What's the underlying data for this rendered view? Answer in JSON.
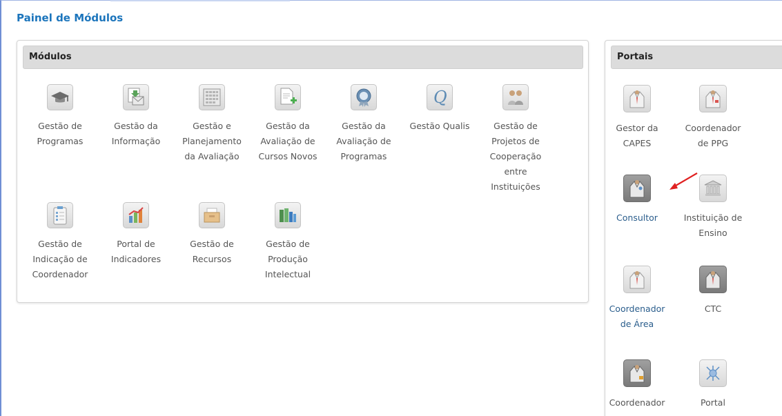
{
  "page": {
    "title": "Painel de Módulos"
  },
  "modulos": {
    "header": "Módulos",
    "items": [
      {
        "label": "Gestão de Programas",
        "icon": "graduation-cap-icon"
      },
      {
        "label": "Gestão da Informação",
        "icon": "document-mail-icon"
      },
      {
        "label": "Gestão e Planejamento da Avaliação",
        "icon": "calendar-grid-icon"
      },
      {
        "label": "Gestão da Avaliação de Cursos Novos",
        "icon": "document-add-icon"
      },
      {
        "label": "Gestão da Avaliação de Programas",
        "icon": "award-rosette-icon"
      },
      {
        "label": "Gestão Qualis",
        "icon": "qualis-q-icon"
      },
      {
        "label": "Gestão de Projetos de Cooperação entre Instituições",
        "icon": "people-cooperation-icon"
      },
      {
        "label": "Gestão de Indicação de Coordenador",
        "icon": "clipboard-list-icon"
      },
      {
        "label": "Portal de Indicadores",
        "icon": "chart-indicators-icon"
      },
      {
        "label": "Gestão de Recursos",
        "icon": "folder-box-icon"
      },
      {
        "label": "Gestão de Produção Intelectual",
        "icon": "books-icon"
      }
    ]
  },
  "portais": {
    "header": "Portais",
    "items": [
      {
        "label": "Gestor da CAPES",
        "icon": "user-coat-icon"
      },
      {
        "label": "Coordenador de PPG",
        "icon": "user-coat-tie-icon"
      },
      {
        "label": "Consultor",
        "icon": "user-coat-dark-icon"
      },
      {
        "label": "Instituição de Ensino",
        "icon": "institution-building-icon"
      },
      {
        "label": "Coordenador de Área",
        "icon": "user-coat-tie-icon"
      },
      {
        "label": "CTC",
        "icon": "user-coat-dark-icon"
      },
      {
        "label": "Coordenador",
        "icon": "user-coat-dark-icon"
      },
      {
        "label": "Portal",
        "icon": "globe-network-icon"
      }
    ]
  },
  "colors": {
    "title": "#1c75bc",
    "link_blue": "#2a5d8c",
    "annotation_arrow": "#e02020"
  }
}
